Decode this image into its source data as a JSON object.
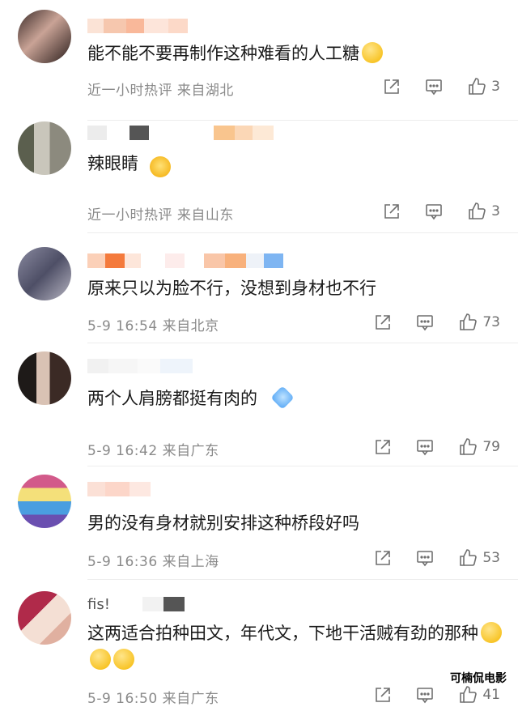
{
  "comments": [
    {
      "username": "",
      "content": "能不能不要再制作这种难看的人工糖",
      "meta": "近一小时热评  来自湖北",
      "likes": "3",
      "emoji": "🤭"
    },
    {
      "username": "",
      "content": "辣眼睛",
      "meta": "近一小时热评  来自山东",
      "likes": "3",
      "emoji": ""
    },
    {
      "username": "",
      "content": "原来只以为脸不行，没想到身材也不行",
      "meta": "5-9 16:54  来自北京",
      "likes": "73",
      "emoji": ""
    },
    {
      "username": "",
      "content": "两个人肩膀都挺有肉的",
      "meta": "5-9 16:42  来自广东",
      "likes": "79",
      "emoji": ""
    },
    {
      "username": "",
      "content": "男的没有身材就别安排这种桥段好吗",
      "meta": "5-9 16:36  来自上海",
      "likes": "53",
      "emoji": ""
    },
    {
      "username": "fis!",
      "content": "这两适合拍种田文，年代文，下地干活贼有劲的那种",
      "meta": "5-9 16:50  来自广东",
      "likes": "41",
      "emoji": ""
    }
  ],
  "watermark": "可楠侃电影",
  "colors": {
    "text": "#1a1a1a",
    "meta": "#8a8a8a",
    "icon": "#6f6f6f",
    "divider": "#ededed"
  }
}
